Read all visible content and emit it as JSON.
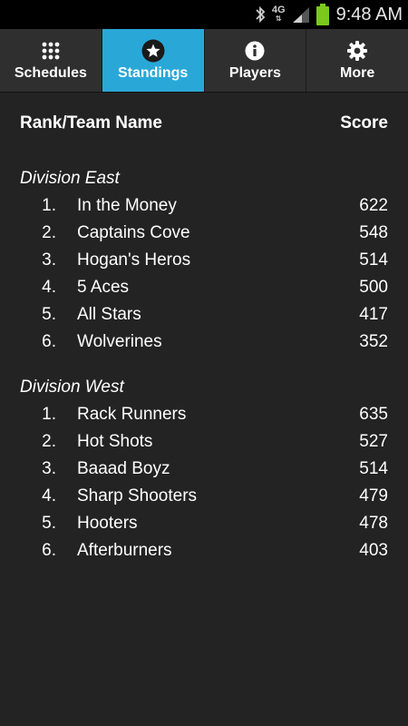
{
  "status_bar": {
    "network": "4G",
    "time": "9:48 AM"
  },
  "tabs": [
    {
      "label": "Schedules",
      "icon": "grid-icon",
      "active": false
    },
    {
      "label": "Standings",
      "icon": "star-icon",
      "active": true
    },
    {
      "label": "Players",
      "icon": "info-icon",
      "active": false
    },
    {
      "label": "More",
      "icon": "gear-icon",
      "active": false
    }
  ],
  "table": {
    "rank_header": "Rank/Team Name",
    "score_header": "Score"
  },
  "divisions": [
    {
      "name": "Division East",
      "teams": [
        {
          "rank": "1.",
          "name": "In the Money",
          "score": "622"
        },
        {
          "rank": "2.",
          "name": "Captains Cove",
          "score": "548"
        },
        {
          "rank": "3.",
          "name": "Hogan's Heros",
          "score": "514"
        },
        {
          "rank": "4.",
          "name": "5 Aces",
          "score": "500"
        },
        {
          "rank": "5.",
          "name": "All Stars",
          "score": "417"
        },
        {
          "rank": "6.",
          "name": "Wolverines",
          "score": "352"
        }
      ]
    },
    {
      "name": "Division West",
      "teams": [
        {
          "rank": "1.",
          "name": "Rack Runners",
          "score": "635"
        },
        {
          "rank": "2.",
          "name": "Hot Shots",
          "score": "527"
        },
        {
          "rank": "3.",
          "name": "Baaad Boyz",
          "score": "514"
        },
        {
          "rank": "4.",
          "name": "Sharp Shooters",
          "score": "479"
        },
        {
          "rank": "5.",
          "name": "Hooters",
          "score": "478"
        },
        {
          "rank": "6.",
          "name": "Afterburners",
          "score": "403"
        }
      ]
    }
  ],
  "colors": {
    "accent": "#29a8d8",
    "background": "#232323",
    "battery": "#7bc91c"
  }
}
